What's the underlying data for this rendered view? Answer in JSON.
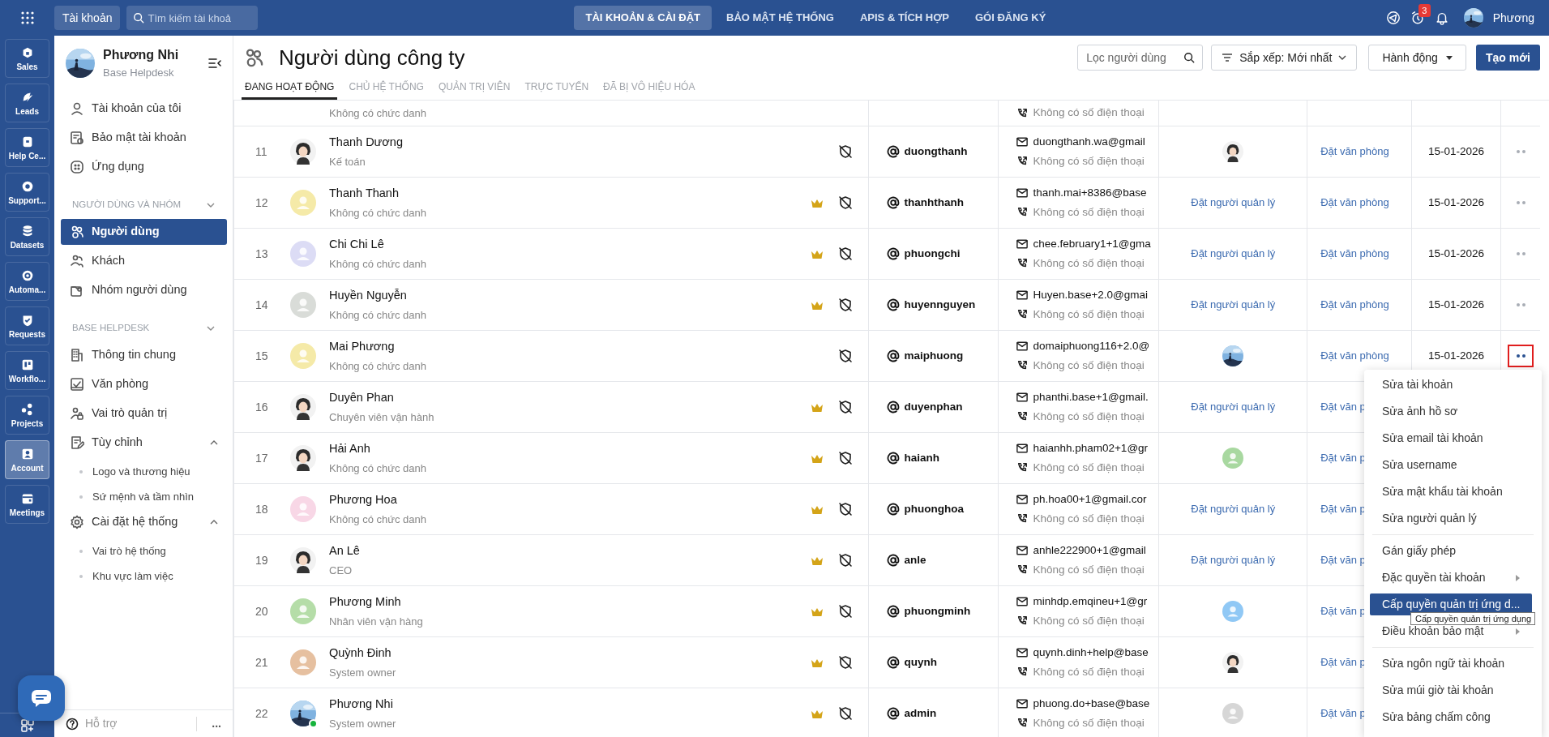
{
  "top_bar": {
    "app_button": "Tài khoản",
    "search": {
      "placeholder": "Tìm kiếm tài khoả"
    },
    "tabs": [
      {
        "label": "TÀI KHOẢN & CÀI ĐẶT",
        "selected": true
      },
      {
        "label": "BẢO MẬT HỆ THỐNG",
        "selected": false
      },
      {
        "label": "APIS & TÍCH HỢP",
        "selected": false
      },
      {
        "label": "GÓI ĐĂNG KÝ",
        "selected": false
      }
    ],
    "alarm_badge": "3",
    "user_name": "Phương"
  },
  "rail": [
    {
      "label": "Sales",
      "selected": false
    },
    {
      "label": "Leads",
      "selected": false
    },
    {
      "label": "Help Ce...",
      "selected": false
    },
    {
      "label": "Support...",
      "selected": false
    },
    {
      "label": "Datasets",
      "selected": false
    },
    {
      "label": "Automa...",
      "selected": false
    },
    {
      "label": "Requests",
      "selected": false
    },
    {
      "label": "Workflo...",
      "selected": false
    },
    {
      "label": "Projects",
      "selected": false
    },
    {
      "label": "Account",
      "selected": true
    },
    {
      "label": "Meetings",
      "selected": false
    }
  ],
  "sidebar": {
    "profile": {
      "name": "Phương Nhi",
      "subtitle": "Base Helpdesk"
    },
    "top_items": [
      {
        "label": "Tài khoản của tôi",
        "selected": false
      },
      {
        "label": "Bảo mật tài khoản",
        "selected": false
      },
      {
        "label": "Ứng dụng",
        "selected": false
      }
    ],
    "sections": [
      {
        "title": "NGƯỜI DÙNG VÀ NHÓM",
        "items": [
          {
            "label": "Người dùng",
            "selected": true
          },
          {
            "label": "Khách",
            "selected": false
          },
          {
            "label": "Nhóm người dùng",
            "selected": false
          }
        ]
      },
      {
        "title": "BASE HELPDESK",
        "items": [
          {
            "label": "Thông tin chung",
            "selected": false
          },
          {
            "label": "Văn phòng",
            "selected": false
          },
          {
            "label": "Vai trò quản trị",
            "selected": false
          },
          {
            "label": "Tùy chỉnh",
            "selected": false,
            "expanded": true,
            "children": [
              {
                "label": "Logo và thương hiệu"
              },
              {
                "label": "Sứ mệnh và tầm nhìn"
              }
            ]
          },
          {
            "label": "Cài đặt hệ thống",
            "selected": false,
            "expanded": true,
            "children": [
              {
                "label": "Vai trò hệ thống"
              },
              {
                "label": "Khu vực làm việc"
              }
            ]
          }
        ]
      }
    ],
    "support": "Hỗ trợ",
    "more": "..."
  },
  "header": {
    "title": "Người dùng công ty",
    "tabs": [
      {
        "label": "ĐANG HOẠT ĐỘNG",
        "selected": true
      },
      {
        "label": "CHỦ HỆ THỐNG",
        "selected": false
      },
      {
        "label": "QUẢN TRỊ VIÊN",
        "selected": false
      },
      {
        "label": "TRỰC TUYẾN",
        "selected": false
      },
      {
        "label": "ĐÃ BỊ VÔ HIỆU HÓA",
        "selected": false
      }
    ],
    "filter": {
      "placeholder": "Lọc người dùng"
    },
    "sort": "Sắp xếp: Mới nhất",
    "actions": "Hành động",
    "create": "Tạo mới"
  },
  "rows": [
    {
      "kind": "partial",
      "title": "Không có chức danh",
      "phone": "Không có số điện thoại"
    },
    {
      "kind": "full",
      "number": "11",
      "avatar": {
        "kind": "figure"
      },
      "online": false,
      "name": "Thanh Dương",
      "title": "Kế toán",
      "crown": false,
      "username": "duongthanh",
      "email": "duongthanh.wa@gmail",
      "phone": "Không có số điện thoại",
      "manager": {
        "kind": "avatar",
        "avatar": {
          "kind": "figure"
        }
      },
      "office": "Đặt văn phòng",
      "date": "15-01-2026",
      "menu_button": {
        "highlighted": false
      }
    },
    {
      "kind": "full",
      "number": "12",
      "avatar": {
        "kind": "placeholder",
        "color": "#f5eaa8"
      },
      "online": false,
      "name": "Thanh Thanh",
      "title": "Không có chức danh",
      "crown": true,
      "username": "thanhthanh",
      "email": "thanh.mai+8386@base",
      "phone": "Không có số điện thoại",
      "manager": {
        "kind": "link",
        "text": "Đặt người quản lý"
      },
      "office": "Đặt văn phòng",
      "date": "15-01-2026",
      "menu_button": {
        "highlighted": false
      }
    },
    {
      "kind": "full",
      "number": "13",
      "avatar": {
        "kind": "placeholder",
        "color": "#dcdcf5"
      },
      "online": false,
      "name": "Chi Chi Lê",
      "title": "Không có chức danh",
      "crown": true,
      "username": "phuongchi",
      "email": "chee.february1+1@gma",
      "phone": "Không có số điện thoại",
      "manager": {
        "kind": "link",
        "text": "Đặt người quản lý"
      },
      "office": "Đặt văn phòng",
      "date": "15-01-2026",
      "menu_button": {
        "highlighted": false
      }
    },
    {
      "kind": "full",
      "number": "14",
      "avatar": {
        "kind": "placeholder",
        "color": "#d9dcd8"
      },
      "online": false,
      "name": "Huyền Nguyễn",
      "title": "Không có chức danh",
      "crown": true,
      "username": "huyennguyen",
      "email": "Huyen.base+2.0@gmai",
      "phone": "Không có số điện thoại",
      "manager": {
        "kind": "link",
        "text": "Đặt người quản lý"
      },
      "office": "Đặt văn phòng",
      "date": "15-01-2026",
      "menu_button": {
        "highlighted": false
      }
    },
    {
      "kind": "full",
      "number": "15",
      "avatar": {
        "kind": "placeholder",
        "color": "#f5eaa8"
      },
      "online": false,
      "name": "Mai Phương",
      "title": "Không có chức danh",
      "crown": false,
      "username": "maiphuong",
      "email": "domaiphuong116+2.0@",
      "phone": "Không có số điện thoại",
      "manager": {
        "kind": "avatar"
      },
      "office": "Đặt văn phòng",
      "date": "15-01-2026",
      "menu_button": {
        "highlighted": true
      }
    },
    {
      "kind": "full",
      "number": "16",
      "avatar": {
        "kind": "figure"
      },
      "online": false,
      "name": "Duyên Phan",
      "title": "Chuyên viên vận hành",
      "crown": true,
      "username": "duyenphan",
      "email": "phanthi.base+1@gmail.",
      "phone": "Không có số điện thoại",
      "manager": {
        "kind": "link",
        "text": "Đặt người quản lý"
      },
      "office": "Đặt văn p"
    },
    {
      "kind": "full",
      "number": "17",
      "avatar": {
        "kind": "figure"
      },
      "online": false,
      "name": "Hải Anh",
      "title": "Không có chức danh",
      "crown": true,
      "username": "haianh",
      "email": "haianhh.pham02+1@gr",
      "phone": "Không có số điện thoại",
      "manager": {
        "kind": "avatar",
        "avatar": {
          "kind": "placeholder",
          "color": "#a8d8a0"
        }
      },
      "office": "Đặt văn p"
    },
    {
      "kind": "full",
      "number": "18",
      "avatar": {
        "kind": "placeholder",
        "color": "#f8d7e6"
      },
      "online": false,
      "name": "Phương Hoa",
      "title": "Không có chức danh",
      "crown": true,
      "username": "phuonghoa",
      "email": "ph.hoa00+1@gmail.cor",
      "phone": "Không có số điện thoại",
      "manager": {
        "kind": "link",
        "text": "Đặt người quản lý"
      },
      "office": "Đặt văn p"
    },
    {
      "kind": "full",
      "number": "19",
      "avatar": {
        "kind": "figure"
      },
      "online": false,
      "name": "An Lê",
      "title": "CEO",
      "crown": true,
      "username": "anle",
      "email": "anhle222900+1@gmail",
      "phone": "Không có số điện thoại",
      "manager": {
        "kind": "link",
        "text": "Đặt người quản lý"
      },
      "office": "Đặt văn p"
    },
    {
      "kind": "full",
      "number": "20",
      "avatar": {
        "kind": "placeholder",
        "color": "#b5dda8"
      },
      "online": false,
      "name": "Phương Minh",
      "title": "Nhân viên vận hàng",
      "crown": true,
      "username": "phuongminh",
      "email": "minhdp.emqineu+1@gr",
      "phone": "Không có số điện thoại",
      "manager": {
        "kind": "avatar",
        "avatar": {
          "kind": "placeholder",
          "color": "#90c8f5"
        }
      },
      "office": "Đặt văn p"
    },
    {
      "kind": "full",
      "number": "21",
      "avatar": {
        "kind": "placeholder",
        "color": "#e6c0a0"
      },
      "online": false,
      "name": "Quỳnh Đinh",
      "title": "System owner",
      "crown": true,
      "username": "quynh",
      "email": "quynh.dinh+help@base",
      "phone": "Không có số điện thoại",
      "manager": {
        "kind": "avatar",
        "avatar": {
          "kind": "figure"
        }
      },
      "office": "Đặt văn p"
    },
    {
      "kind": "full",
      "number": "22",
      "online": true,
      "name": "Phương Nhi",
      "title": "System owner",
      "crown": true,
      "username": "admin",
      "email": "phuong.do+base@base",
      "phone": "Không có số điện thoại",
      "manager": {
        "kind": "avatar",
        "avatar": {
          "kind": "placeholder",
          "color": "#d6d6d6"
        }
      },
      "office": "Đặt văn p"
    }
  ],
  "context_menu": {
    "groups": [
      [
        {
          "label": "Sửa tài khoản",
          "selected": false,
          "submenu": false
        },
        {
          "label": "Sửa ảnh hồ sơ",
          "selected": false,
          "submenu": false
        },
        {
          "label": "Sửa email tài khoản",
          "selected": false,
          "submenu": false
        },
        {
          "label": "Sửa username",
          "selected": false,
          "submenu": false
        },
        {
          "label": "Sửa mật khẩu tài khoản",
          "selected": false,
          "submenu": false
        },
        {
          "label": "Sửa người quản lý",
          "selected": false,
          "submenu": false
        }
      ],
      [
        {
          "label": "Gán giấy phép",
          "selected": false,
          "submenu": false
        },
        {
          "label": "Đặc quyền tài khoản",
          "selected": false,
          "submenu": true
        },
        {
          "label": "Cấp quyền quản trị ứng d...",
          "selected": true,
          "submenu": false
        },
        {
          "label": "Điều khoản bảo mật",
          "selected": false,
          "submenu": true
        }
      ],
      [
        {
          "label": "Sửa ngôn ngữ tài khoản",
          "selected": false,
          "submenu": false
        },
        {
          "label": "Sửa múi giờ tài khoản",
          "selected": false,
          "submenu": false
        },
        {
          "label": "Sửa bảng chấm công",
          "selected": false,
          "submenu": false
        }
      ]
    ],
    "tooltip": "Cấp quyền quản trị ứng dụng"
  }
}
